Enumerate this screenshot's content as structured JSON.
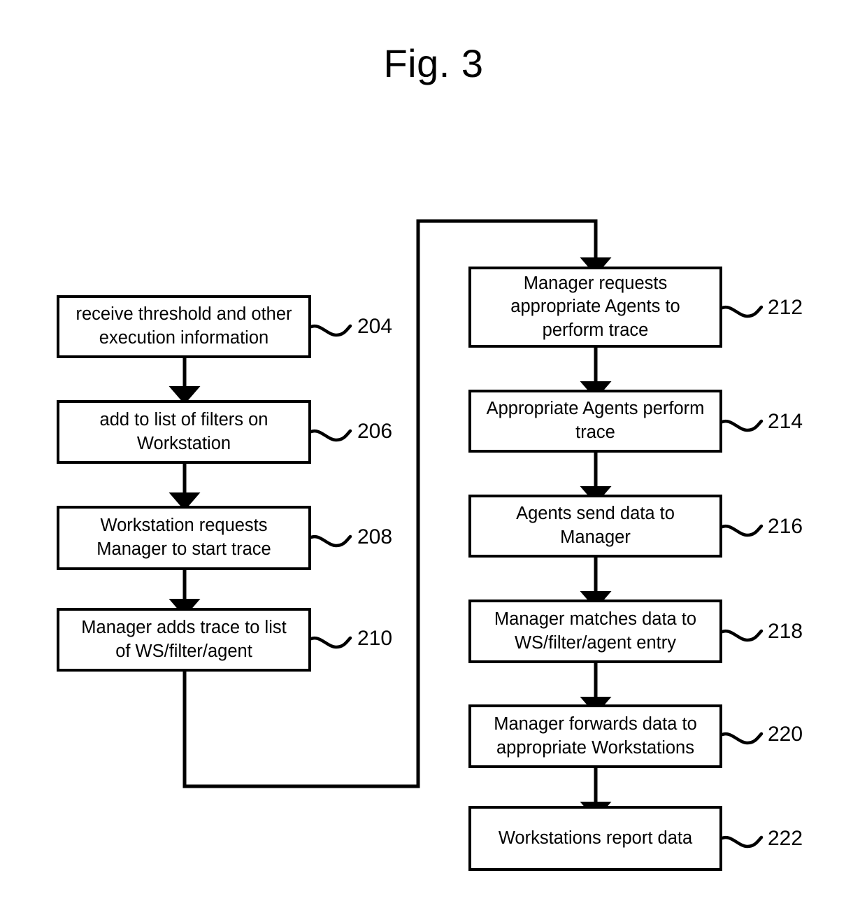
{
  "figure": {
    "title": "Fig. 3",
    "type": "patent-flowchart",
    "background_color": "#ffffff",
    "line_color": "#000000"
  },
  "nodes": [
    {
      "id": "204",
      "ref": "204",
      "text": "receive threshold and other\nexecution information",
      "column": "left",
      "order": 1
    },
    {
      "id": "206",
      "ref": "206",
      "text": "add to list of filters on\nWorkstation",
      "column": "left",
      "order": 2
    },
    {
      "id": "208",
      "ref": "208",
      "text": "Workstation requests\nManager to start trace",
      "column": "left",
      "order": 3
    },
    {
      "id": "210",
      "ref": "210",
      "text": "Manager adds trace to list\nof WS/filter/agent",
      "column": "left",
      "order": 4
    },
    {
      "id": "212",
      "ref": "212",
      "text": "Manager requests\nappropriate Agents to\nperform trace",
      "column": "right",
      "order": 5
    },
    {
      "id": "214",
      "ref": "214",
      "text": "Appropriate Agents perform\ntrace",
      "column": "right",
      "order": 6
    },
    {
      "id": "216",
      "ref": "216",
      "text": "Agents send data to\nManager",
      "column": "right",
      "order": 7
    },
    {
      "id": "218",
      "ref": "218",
      "text": "Manager matches data to\nWS/filter/agent entry",
      "column": "right",
      "order": 8
    },
    {
      "id": "220",
      "ref": "220",
      "text": "Manager forwards data to\nappropriate Workstations",
      "column": "right",
      "order": 9
    },
    {
      "id": "222",
      "ref": "222",
      "text": "Workstations report data",
      "column": "right",
      "order": 10
    }
  ],
  "edges": [
    {
      "from": "204",
      "to": "206",
      "style": "straight-down-arrow"
    },
    {
      "from": "206",
      "to": "208",
      "style": "straight-down-arrow"
    },
    {
      "from": "208",
      "to": "210",
      "style": "straight-down-arrow"
    },
    {
      "from": "210",
      "to": "212",
      "style": "loop-down-right-up-arrow"
    },
    {
      "from": "212",
      "to": "214",
      "style": "straight-down-arrow"
    },
    {
      "from": "214",
      "to": "216",
      "style": "straight-down-arrow"
    },
    {
      "from": "216",
      "to": "218",
      "style": "straight-down-arrow"
    },
    {
      "from": "218",
      "to": "220",
      "style": "straight-down-arrow"
    },
    {
      "from": "220",
      "to": "222",
      "style": "straight-down-arrow"
    }
  ]
}
